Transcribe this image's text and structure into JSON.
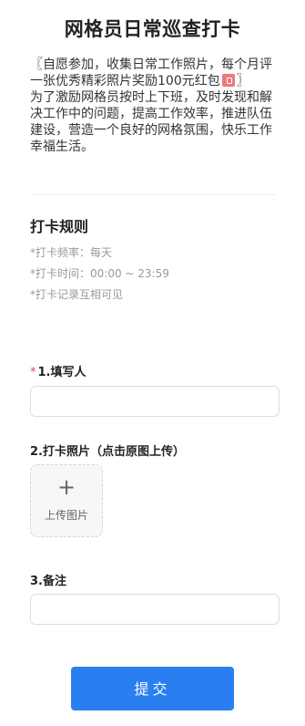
{
  "header": {
    "title": "网格员日常巡查打卡"
  },
  "intro": {
    "line1_pre": "〖自愿参加，收集日常工作照片，每个月评一张优秀精彩照片奖励100元红包",
    "line1_post": "〗",
    "line2": "为了激励网格员按时上下班，及时发现和解决工作中的问题，提高工作效率，推进队伍建设，营造一个良好的网格氛围，快乐工作幸福生活。",
    "badge_icon": "red-envelope-icon",
    "badge_color": "#ef7777"
  },
  "rules": {
    "title": "打卡规则",
    "items": [
      "*打卡频率：每天",
      "*打卡时间：00:00 ~ 23:59",
      "*打卡记录互相可见"
    ]
  },
  "form": {
    "field1": {
      "required_mark": "*",
      "label": "1.填写人",
      "value": ""
    },
    "field2": {
      "label": "2.打卡照片（点击原图上传）",
      "upload_icon": "plus-icon",
      "upload_label": "上传图片"
    },
    "field3": {
      "label": "3.备注",
      "value": ""
    },
    "submit_label": "提交"
  },
  "colors": {
    "accent": "#2a7ff0",
    "required": "#ee4444"
  }
}
